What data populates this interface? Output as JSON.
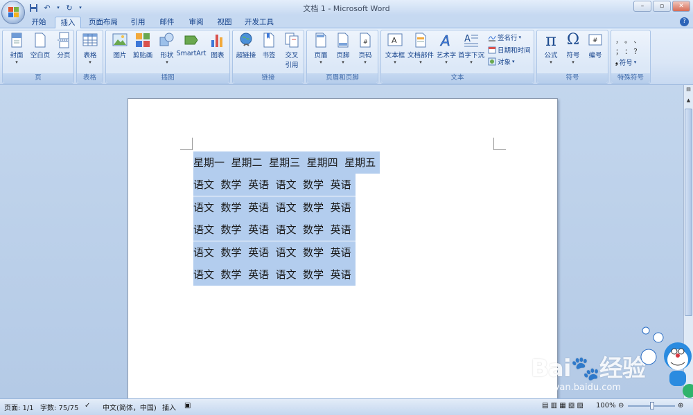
{
  "window": {
    "title": "文档 1 - Microsoft Word",
    "controls": [
      "–",
      "▫",
      "✕"
    ]
  },
  "tabs": [
    {
      "label": "开始",
      "active": false
    },
    {
      "label": "插入",
      "active": true
    },
    {
      "label": "页面布局",
      "active": false
    },
    {
      "label": "引用",
      "active": false
    },
    {
      "label": "邮件",
      "active": false
    },
    {
      "label": "审阅",
      "active": false
    },
    {
      "label": "视图",
      "active": false
    },
    {
      "label": "开发工具",
      "active": false
    }
  ],
  "ribbon": {
    "groups": {
      "page": "页",
      "table": "表格",
      "illustration": "插图",
      "link": "链接",
      "header_footer": "页眉和页脚",
      "text": "文本",
      "symbol": "符号",
      "special_symbol": "特殊符号"
    },
    "buttons": {
      "cover": "封面",
      "blank_page": "空白页",
      "page_break": "分页",
      "table": "表格",
      "picture": "图片",
      "clipart": "剪贴画",
      "shapes": "形状",
      "smartart": "SmartArt",
      "chart": "图表",
      "hyperlink": "超链接",
      "bookmark": "书签",
      "cross_ref_1": "交叉",
      "cross_ref_2": "引用",
      "header": "页眉",
      "footer": "页脚",
      "page_number": "页码",
      "textbox": "文本框",
      "quick_parts": "文档部件",
      "wordart": "艺术字",
      "dropcap": "首字下沉",
      "signature_line": "签名行",
      "date_time": "日期和时间",
      "object": "对象",
      "equation": "公式",
      "symbol": "符号",
      "number": "编号",
      "special_symbol_btn": "符号",
      "punct_row1": "，  。  、",
      "punct_row2": "；  ：  ？"
    }
  },
  "document": {
    "lines": [
      "星期一  星期二  星期三  星期四  星期五",
      "语文  数学  英语  语文  数学  英语",
      "语文  数学  英语  语文  数学  英语",
      "语文  数学  英语  语文  数学  英语",
      "语文  数学  英语  语文  数学  英语",
      "语文  数学  英语  语文  数学  英语"
    ]
  },
  "statusbar": {
    "page": "页面: 1/1",
    "words": "字数: 75/75",
    "language": "中文(简体，中国)",
    "mode": "插入",
    "zoom": "100%"
  },
  "watermark": {
    "brand": "Bai",
    "brand2": "经验",
    "url": "jingyan.baidu.com"
  },
  "colors": {
    "selection": "#b3cdee",
    "ribbon": "#dae6f6",
    "workspace": "#b4cae6"
  }
}
